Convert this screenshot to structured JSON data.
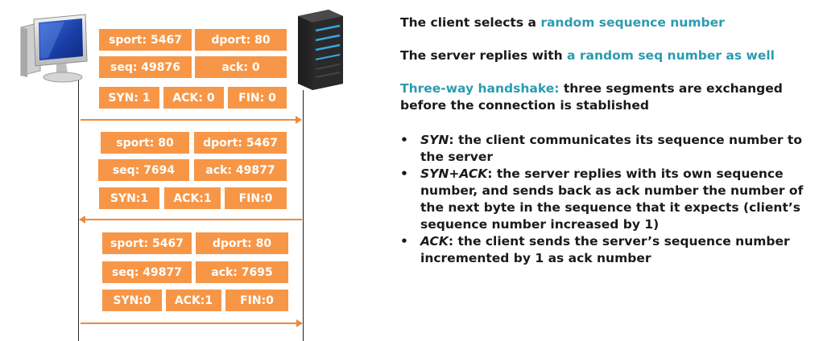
{
  "segments": [
    {
      "direction": "client-to-server",
      "sport": "sport: 5467",
      "dport": "dport: 80",
      "seq": "seq: 49876",
      "ack": "ack: 0",
      "syn": "SYN: 1",
      "ackflag": "ACK: 0",
      "fin": "FIN: 0"
    },
    {
      "direction": "server-to-client",
      "sport": "sport: 80",
      "dport": "dport: 5467",
      "seq": "seq: 7694",
      "ack": "ack: 49877",
      "syn": "SYN:1",
      "ackflag": "ACK:1",
      "fin": "FIN:0"
    },
    {
      "direction": "client-to-server",
      "sport": "sport: 5467",
      "dport": "dport: 80",
      "seq": "seq: 49877",
      "ack": "ack: 7695",
      "syn": "SYN:0",
      "ackflag": "ACK:1",
      "fin": "FIN:0"
    }
  ],
  "icons": {
    "client": "computer-monitor-icon",
    "server": "server-tower-icon"
  },
  "colors": {
    "box": "#f79646",
    "arrow": "#f0883e",
    "highlight": "#2b9bb0",
    "text": "#1a1a1a"
  },
  "explanation": {
    "line1_prefix": "The client selects a ",
    "line1_highlight": "random sequence number",
    "line2_prefix": "The server replies with ",
    "line2_highlight": "a random seq number as well",
    "handshake_highlight": "Three-way handshake:",
    "handshake_rest": " three segments are exchanged before the connection is stablished",
    "bullets": [
      {
        "term": "SYN",
        "text": ": the client communicates its sequence number to the server"
      },
      {
        "term": "SYN+ACK",
        "text": ": the server replies with its own sequence number, and sends back  as ack number the number of the next byte in the sequence that it expects (client’s sequence number increased by 1)"
      },
      {
        "term": "ACK",
        "text": ": the client sends the server’s sequence number incremented by 1 as ack number"
      }
    ]
  }
}
